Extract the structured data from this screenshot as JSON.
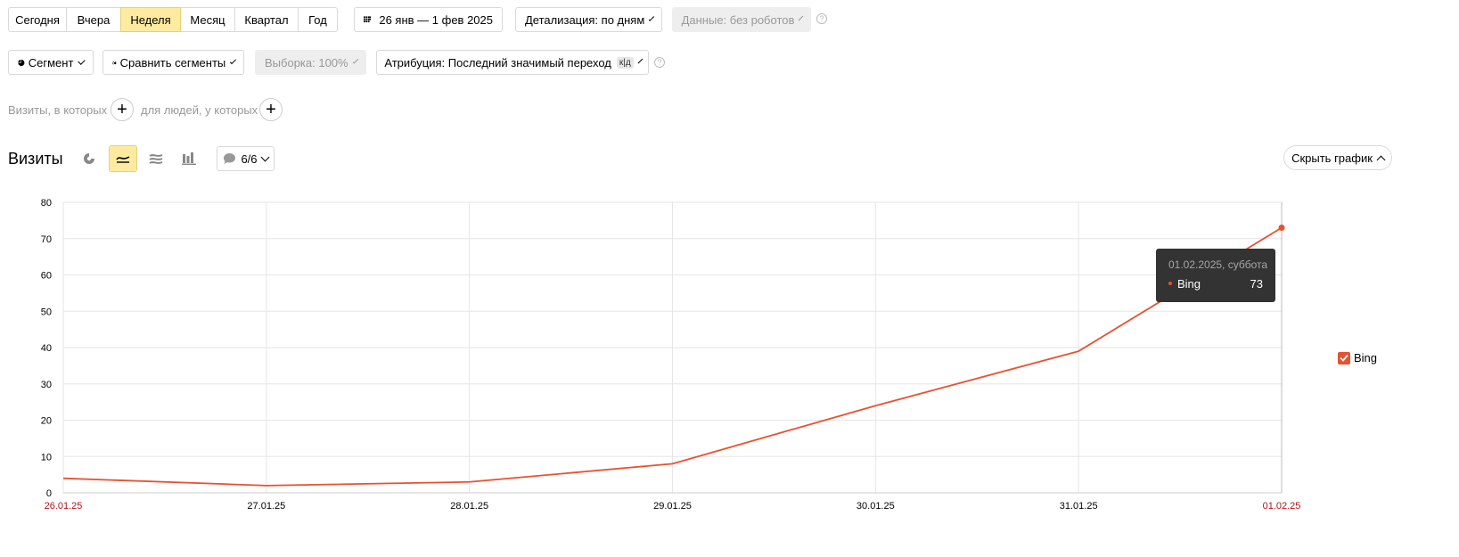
{
  "period_tabs": [
    {
      "label": "Сегодня",
      "active": false
    },
    {
      "label": "Вчера",
      "active": false
    },
    {
      "label": "Неделя",
      "active": true
    },
    {
      "label": "Месяц",
      "active": false
    },
    {
      "label": "Квартал",
      "active": false
    },
    {
      "label": "Год",
      "active": false
    }
  ],
  "date_range": {
    "label": "26 янв — 1 фев 2025",
    "icon": "calendar-icon"
  },
  "detail": {
    "label": "Детализация: по дням"
  },
  "data_filter": {
    "label": "Данные: без роботов",
    "disabled": true
  },
  "segment": {
    "label": "Сегмент",
    "icon": "pie-icon"
  },
  "compare": {
    "label": "Сравнить сегменты",
    "icon": "compare-icon"
  },
  "sample": {
    "label": "Выборка: 100%",
    "disabled": true
  },
  "attribution": {
    "label": "Атрибуция: Последний значимый переход",
    "badge": "к|д"
  },
  "filters": {
    "visits_label": "Визиты, в которых",
    "people_label": "для людей, у которых",
    "plus": "+"
  },
  "report": {
    "title": "Визиты",
    "annotations": "6/6",
    "hide_chart": "Скрыть график"
  },
  "tooltip": {
    "date": "01.02.2025, суббота",
    "series": "Bing",
    "value": "73"
  },
  "legend": [
    {
      "label": "Bing",
      "checked": true,
      "color": "#e8512f"
    }
  ],
  "chart_data": {
    "type": "line",
    "categories": [
      "26.01.25",
      "27.01.25",
      "28.01.25",
      "29.01.25",
      "30.01.25",
      "31.01.25",
      "01.02.25"
    ],
    "weekend_categories": [
      "26.01.25",
      "01.02.25"
    ],
    "series": [
      {
        "name": "Bing",
        "values": [
          4,
          2,
          3,
          8,
          24,
          39,
          73
        ],
        "color": "#e8512f"
      }
    ],
    "ylim": [
      0,
      80
    ],
    "yticks": [
      "0",
      "10",
      "20",
      "30",
      "40",
      "50",
      "60",
      "70",
      "80"
    ],
    "grid": true,
    "legend_position": "right"
  }
}
